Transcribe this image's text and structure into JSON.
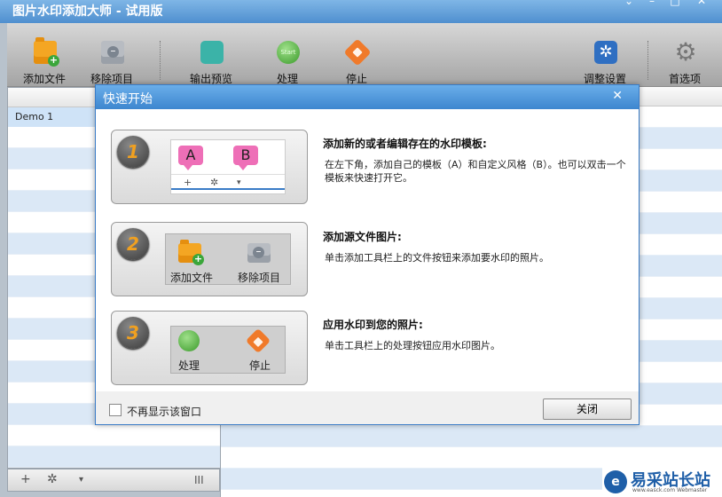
{
  "app": {
    "title": "图片水印添加大师 - 试用版"
  },
  "window_controls": {
    "dropdown": "⌄",
    "minimize": "–",
    "maximize": "□",
    "close": "✕"
  },
  "toolbar": {
    "add_file": "添加文件",
    "remove_item": "移除项目",
    "output_preview": "输出预览",
    "process": "处理",
    "stop": "停止",
    "adjust_settings": "调整设置",
    "preferences": "首选项",
    "start_icon_text": "Start"
  },
  "list": {
    "items": [
      "Demo 1"
    ]
  },
  "bottombar": {
    "add": "+",
    "gear": "✲",
    "dropdown": "▾",
    "columns": "III"
  },
  "dialog": {
    "title": "快速开始",
    "close_x": "✕",
    "steps": [
      {
        "number": "1",
        "title": "添加新的或者编辑存在的水印模板:",
        "desc": "在左下角，添加自己的模板（A）和自定义风格（B）。也可以双击一个模板来快速打开它。",
        "tag_a": "A",
        "tag_b": "B",
        "bar_plus": "+",
        "bar_gear": "✲",
        "bar_drop": "▾"
      },
      {
        "number": "2",
        "title": "添加源文件图片:",
        "desc": "单击添加工具栏上的文件按钮来添加要水印的照片。",
        "label_add": "添加文件",
        "label_remove": "移除项目"
      },
      {
        "number": "3",
        "title": "应用水印到您的照片:",
        "desc": "单击工具栏上的处理按钮应用水印图片。",
        "label_process": "处理",
        "label_stop": "停止"
      }
    ],
    "dont_show": "不再显示该窗口",
    "close_button": "关闭"
  },
  "watermark": {
    "name": "易采站长站",
    "sub": "www.easck.com Webmaster",
    "mark": "e"
  },
  "colors": {
    "accent": "#3d86cf",
    "row_stripe": "#dbe8f6",
    "tag_pink": "#ee6fb7"
  }
}
